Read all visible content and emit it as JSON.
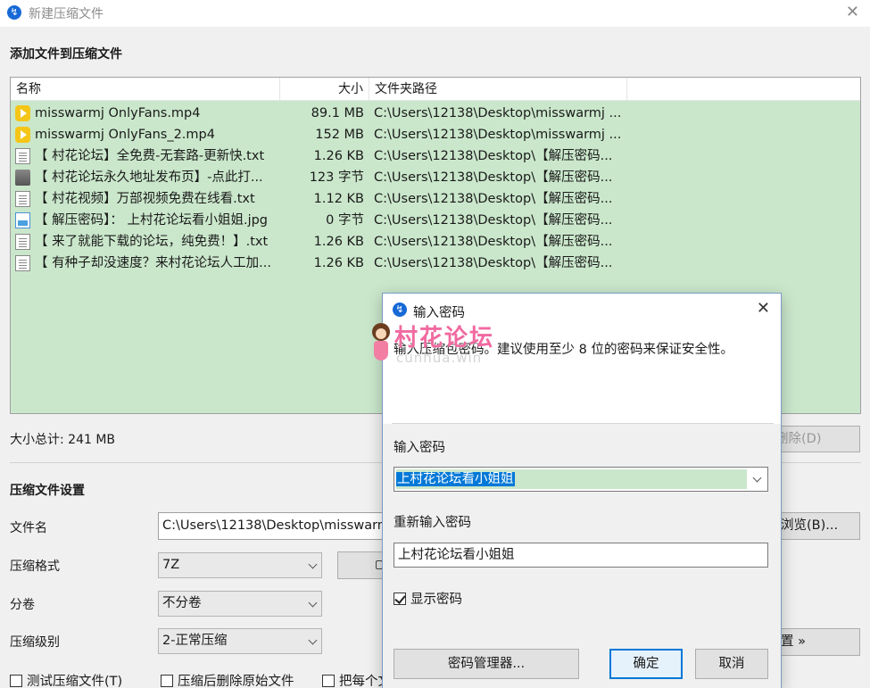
{
  "window": {
    "title": "新建压缩文件",
    "close_glyph": "✕"
  },
  "app_icon_glyph": "↯",
  "files_section": {
    "label": "添加文件到压缩文件",
    "columns": {
      "name": "名称",
      "size": "大小",
      "path": "文件夹路径"
    },
    "rows": [
      {
        "icon": "video-file-icon",
        "name": "misswarmj OnlyFans.mp4",
        "size": "89.1 MB",
        "path": "C:\\Users\\12138\\Desktop\\misswarmj ..."
      },
      {
        "icon": "video-file-icon",
        "name": "misswarmj OnlyFans_2.mp4",
        "size": "152 MB",
        "path": "C:\\Users\\12138\\Desktop\\misswarmj ..."
      },
      {
        "icon": "text-file-icon",
        "name": "【 村花论坛】全免费-无套路-更新快.txt",
        "size": "1.26 KB",
        "path": "C:\\Users\\12138\\Desktop\\【解压密码..."
      },
      {
        "icon": "url-file-icon",
        "name": "【 村花论坛永久地址发布页】-点此打...",
        "size": "123 字节",
        "path": "C:\\Users\\12138\\Desktop\\【解压密码..."
      },
      {
        "icon": "text-file-icon",
        "name": "【 村花视频】万部视频免费在线看.txt",
        "size": "1.12 KB",
        "path": "C:\\Users\\12138\\Desktop\\【解压密码..."
      },
      {
        "icon": "image-file-icon",
        "name": "【 解压密码】：  上村花论坛看小姐姐.jpg",
        "size": "0 字节",
        "path": "C:\\Users\\12138\\Desktop\\【解压密码..."
      },
      {
        "icon": "text-file-icon",
        "name": "【 来了就能下载的论坛，纯免费！】.txt",
        "size": "1.26 KB",
        "path": "C:\\Users\\12138\\Desktop\\【解压密码..."
      },
      {
        "icon": "text-file-icon",
        "name": "【 有种子却没速度？来村花论坛人工加...",
        "size": "1.26 KB",
        "path": "C:\\Users\\12138\\Desktop\\【解压密码..."
      }
    ],
    "total": "大小总计: 241 MB",
    "delete_button": "删除(D)"
  },
  "settings": {
    "label": "压缩文件设置",
    "filename_label": "文件名",
    "filename_value": "C:\\Users\\12138\\Desktop\\misswarmj OnlyFans.7z",
    "browse_button": "浏览(B)...",
    "format_label": "压缩格式",
    "format_value": "7Z",
    "volume_label": "分卷",
    "volume_value": "不分卷",
    "level_label": "压缩级别",
    "level_value": "2-正常压缩",
    "advanced_button": "置 »",
    "checkboxes": {
      "test": "测试压缩文件(T)",
      "delete_after": "压缩后删除原始文件",
      "each_separate": "把每个文"
    }
  },
  "password_dialog": {
    "title": "输入密码",
    "description": "输入压缩包密码。建议使用至少 8 位的密码来保证安全性。",
    "enter_label": "输入密码",
    "enter_value": "上村花论坛看小姐姐",
    "reenter_label": "重新输入密码",
    "reenter_value": "上村花论坛看小姐姐",
    "show_password_label": "显示密码",
    "show_password_checked": true,
    "manager_button": "密码管理器...",
    "ok_button": "确定",
    "cancel_button": "取消"
  },
  "watermark": {
    "text": "村花论坛",
    "sub": "cunhua.win"
  },
  "colors": {
    "accent": "#0078d7",
    "selection_green": "#cae7cb",
    "watermark_pink": "#f06aa0"
  }
}
